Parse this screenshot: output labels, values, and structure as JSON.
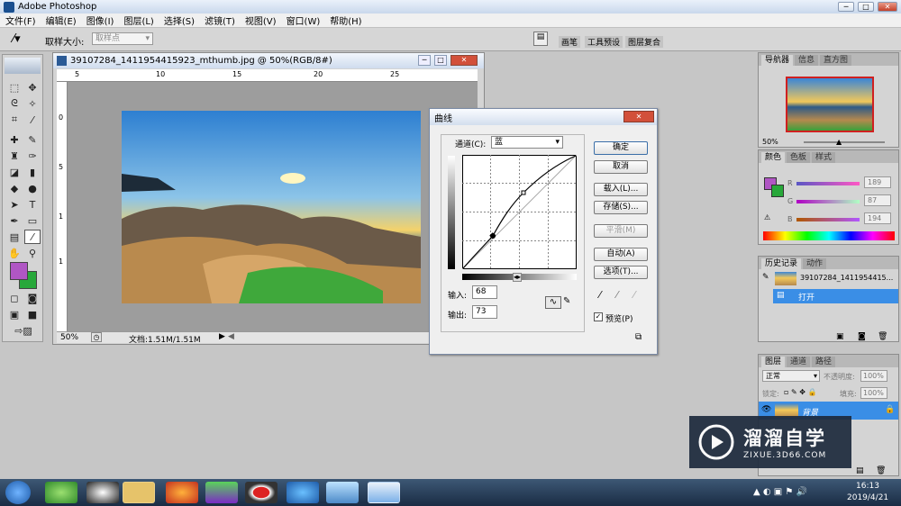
{
  "app": {
    "title": "Adobe Photoshop"
  },
  "menu": [
    "文件(F)",
    "编辑(E)",
    "图像(I)",
    "图层(L)",
    "选择(S)",
    "滤镜(T)",
    "视图(V)",
    "窗口(W)",
    "帮助(H)"
  ],
  "options": {
    "sample_label": "取样大小:",
    "sample_value": "取样点",
    "panel_tabs": [
      "画笔",
      "工具预设",
      "图层复合"
    ]
  },
  "document": {
    "title": "39107284_1411954415923_mthumb.jpg @ 50%(RGB/8#)",
    "zoom": "50%",
    "status": "文档:1.51M/1.51M",
    "ruler_top": [
      "5",
      "10",
      "15",
      "20",
      "25"
    ],
    "ruler_left": [
      "0",
      "5",
      "1",
      "1"
    ]
  },
  "curves": {
    "title": "曲线",
    "channel_label": "通道(C):",
    "channel_value": "蓝",
    "input_label": "输入:",
    "input_value": "68",
    "output_label": "输出:",
    "output_value": "73",
    "buttons": {
      "ok": "确定",
      "cancel": "取消",
      "load": "载入(L)...",
      "save": "存储(S)...",
      "smooth": "平滑(M)",
      "auto": "自动(A)",
      "options": "选项(T)..."
    },
    "preview_label": "预览(P)",
    "preview_checked": true
  },
  "navigator": {
    "tabs": [
      "导航器",
      "信息",
      "直方图"
    ],
    "zoom": "50%"
  },
  "color": {
    "tabs": [
      "颜色",
      "色板",
      "样式"
    ],
    "r_label": "R",
    "g_label": "G",
    "b_label": "B",
    "r": "189",
    "g": "87",
    "b": "194"
  },
  "history": {
    "tabs": [
      "历史记录",
      "动作"
    ],
    "snapshot": "39107284_1411954415...",
    "step": "打开"
  },
  "layers": {
    "tabs": [
      "图层",
      "通道",
      "路径"
    ],
    "blend": "正常",
    "opacity_label": "不透明度:",
    "opacity": "100%",
    "lock_label": "锁定:",
    "fill_label": "填充:",
    "fill": "100%",
    "layer_name": "背景"
  },
  "watermark": {
    "brand": "溜溜自学",
    "url": "ZIXUE.3D66.COM"
  },
  "clock": {
    "time": "16:13",
    "date": "2019/4/21"
  },
  "colors": {
    "foreground": "#b056c4",
    "background": "#28a83a",
    "selection": "#3a8ee6"
  }
}
